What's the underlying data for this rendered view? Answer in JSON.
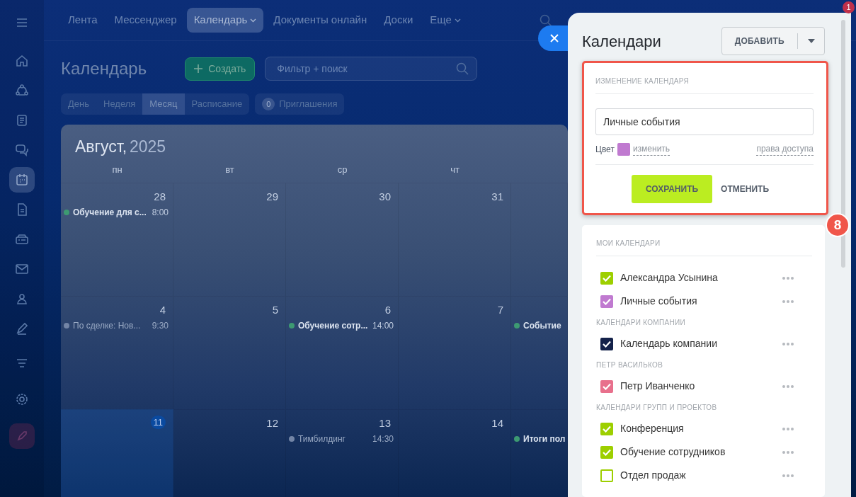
{
  "top_nav": {
    "items": [
      {
        "label": "Лента",
        "selected": false,
        "has_menu": false
      },
      {
        "label": "Мессенджер",
        "selected": false,
        "has_menu": false
      },
      {
        "label": "Календарь",
        "selected": true,
        "has_menu": true
      },
      {
        "label": "Документы онлайн",
        "selected": false,
        "has_menu": false
      },
      {
        "label": "Доски",
        "selected": false,
        "has_menu": false
      },
      {
        "label": "Еще",
        "selected": false,
        "has_menu": true
      }
    ],
    "notification_count": "1"
  },
  "sidebar": {
    "items": [
      {
        "selected": false
      },
      {
        "selected": false
      },
      {
        "selected": false
      },
      {
        "selected": false
      },
      {
        "selected": true
      },
      {
        "selected": false
      },
      {
        "selected": false
      },
      {
        "selected": false
      },
      {
        "selected": false
      },
      {
        "selected": false
      },
      {
        "selected": false
      },
      {
        "selected": false
      }
    ]
  },
  "page": {
    "title": "Календарь",
    "create_button": "Создать",
    "search": {
      "placeholder": "Фильтр + поиск"
    },
    "views": [
      {
        "label": "День",
        "selected": false
      },
      {
        "label": "Неделя",
        "selected": false
      },
      {
        "label": "Месяц",
        "selected": true
      },
      {
        "label": "Расписание",
        "selected": false
      }
    ],
    "invitations": {
      "count": "0",
      "label": "Приглашения"
    }
  },
  "calendar": {
    "month": "Август,",
    "year": "2025",
    "weekdays": [
      "пн",
      "вт",
      "ср",
      "чт"
    ],
    "weeks": [
      {
        "days": [
          {
            "number": "28",
            "today": false,
            "events": [
              {
                "title": "Обучение для с...",
                "time": "8:00",
                "faded": false
              }
            ]
          },
          {
            "number": "29",
            "today": false
          },
          {
            "number": "30",
            "today": false
          },
          {
            "number": "31",
            "today": false
          },
          {
            "today": false
          }
        ]
      },
      {
        "days": [
          {
            "number": "4",
            "today": false,
            "events": [
              {
                "title": "По сделке: Нов...",
                "time": "9:30",
                "faded": true
              }
            ]
          },
          {
            "number": "5",
            "today": false
          },
          {
            "number": "6",
            "today": false,
            "events": [
              {
                "title": "Обучение сотр...",
                "time": "14:00",
                "faded": false
              }
            ]
          },
          {
            "number": "7",
            "today": false
          },
          {
            "today": false,
            "events": [
              {
                "title": "Событие",
                "faded": false
              }
            ]
          }
        ]
      },
      {
        "days": [
          {
            "number": "11",
            "today": true
          },
          {
            "number": "12",
            "today": false
          },
          {
            "number": "13",
            "today": false,
            "events": [
              {
                "title": "Тимбилдинг",
                "time": "14:30",
                "faded": true
              }
            ]
          },
          {
            "number": "14",
            "today": false
          },
          {
            "today": false,
            "events": [
              {
                "title": "Итоги пол",
                "faded": false
              }
            ]
          }
        ]
      }
    ]
  },
  "panel": {
    "title": "Календари",
    "add_button": "ДОБАВИТЬ",
    "annotation": "8",
    "edit": {
      "heading": "ИЗМЕНЕНИЕ КАЛЕНДАРЯ",
      "name_value": "Личные события",
      "color_label": "Цвет",
      "color": "#c07ad0",
      "change_link": "изменить",
      "access_link": "права доступа",
      "save_button": "СОХРАНИТЬ",
      "cancel_button": "ОТМЕНИТЬ"
    },
    "sections": [
      {
        "title": "МОИ КАЛЕНДАРИ",
        "items": [
          {
            "label": "Александра Усынина",
            "checked": true,
            "color": "#9dcf00"
          },
          {
            "label": "Личные события",
            "checked": true,
            "color": "#c07ad0"
          }
        ]
      },
      {
        "title": "КАЛЕНДАРИ КОМПАНИИ",
        "items": [
          {
            "label": "Календарь компании",
            "checked": true,
            "color": "#14224a"
          }
        ]
      },
      {
        "title": "ПЕТР ВАСИЛЬКОВ",
        "items": [
          {
            "label": "Петр Иванченко",
            "checked": true,
            "color": "#e8708c"
          }
        ]
      },
      {
        "title": "КАЛЕНДАРИ ГРУПП И ПРОЕКТОВ",
        "items": [
          {
            "label": "Конференция",
            "checked": true,
            "color": "#9dcf00"
          },
          {
            "label": "Обучение сотрудников",
            "checked": true,
            "color": "#9dcf00"
          },
          {
            "label": "Отдел продаж",
            "checked": false,
            "color": "#9dcf00"
          }
        ]
      }
    ]
  }
}
